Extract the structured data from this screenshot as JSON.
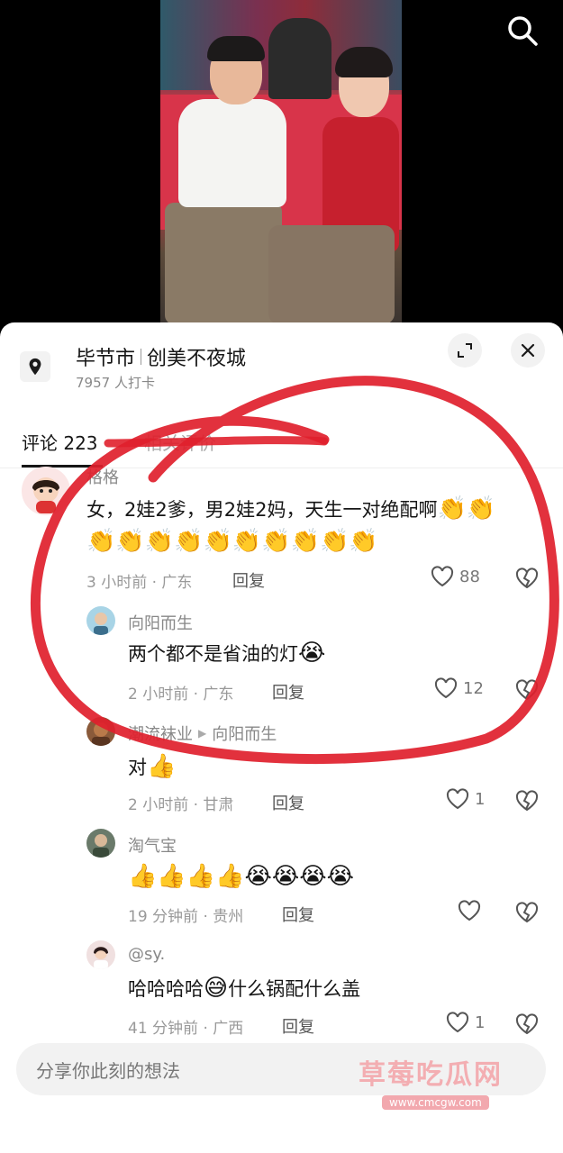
{
  "location": {
    "city": "毕节市",
    "place": "创美不夜城",
    "checkins": "7957 人打卡"
  },
  "tabs": [
    {
      "label": "评论 223"
    },
    {
      "label": "相关评价"
    }
  ],
  "comments": [
    {
      "author": "格格",
      "text": "女，2娃2爹，男2娃2妈，天生一对绝配啊",
      "time_loc": "3 小时前 · 广东",
      "reply": "回复",
      "likes": "88",
      "emoji_icons": [
        "clap-emoji"
      ]
    },
    {
      "author": "向阳而生",
      "text": "两个都不是省油的灯",
      "time_loc": "2 小时前 · 广东",
      "reply": "回复",
      "likes": "12",
      "emoji_icons": [
        "laughing-crying-emoji"
      ]
    },
    {
      "author": "潮流袜业",
      "reply_to": "向阳而生",
      "text": "对",
      "time_loc": "2 小时前 · 甘肃",
      "reply": "回复",
      "likes": "1",
      "emoji_icons": [
        "thumbs-up-emoji"
      ]
    },
    {
      "author": "淘气宝",
      "text": "",
      "time_loc": "19 分钟前 · 贵州",
      "reply": "回复",
      "likes": "",
      "emoji_icons": [
        "thumbs-up-emoji",
        "laughing-crying-emoji"
      ]
    },
    {
      "author": "@sy.",
      "text_before": "哈哈哈哈",
      "text_after": "什么锅配什么盖",
      "time_loc": "41 分钟前 · 广西",
      "reply": "回复",
      "likes": "1",
      "emoji_icons": [
        "grinning-sweat-emoji"
      ]
    }
  ],
  "input": {
    "placeholder": "分享你此刻的想法"
  },
  "watermark": {
    "text": "草莓吃瓜网",
    "url": "www.cmcgw.com"
  },
  "colors": {
    "accent_red": "#e0202c",
    "text_primary": "#161616",
    "text_secondary": "#999999"
  }
}
